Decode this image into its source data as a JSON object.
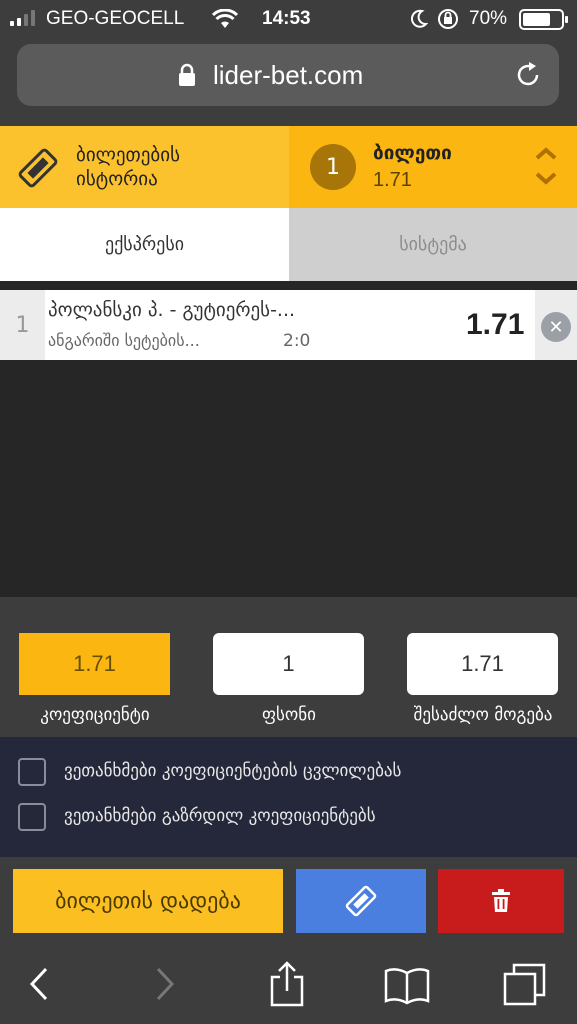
{
  "status_bar": {
    "carrier": "GEO-GEOCELL",
    "time": "14:53",
    "battery": "70%"
  },
  "browser": {
    "url": "lider-bet.com"
  },
  "header": {
    "history_label_line1": "ბილეთების",
    "history_label_line2": "ისტორია",
    "ticket_count": "1",
    "ticket_label": "ბილეთი",
    "ticket_odds": "1.71"
  },
  "tabs": [
    {
      "label": "ექსპრესი",
      "active": true
    },
    {
      "label": "სისტემა",
      "active": false
    }
  ],
  "bets": [
    {
      "index": "1",
      "title": "პოლანსკი პ. - გუტიერეს-...",
      "market": "ანგარიში სეტების...",
      "score": "2:0",
      "odds": "1.71"
    }
  ],
  "calculator": {
    "coefficient": {
      "value": "1.71",
      "caption": "კოეფიციენტი"
    },
    "stake": {
      "value": "1",
      "caption": "ფსონი"
    },
    "possible_win": {
      "value": "1.71",
      "caption": "შესაძლო მოგება"
    }
  },
  "agreements": [
    {
      "label": "ვეთანხმები კოეფიციენტების ცვლილებას",
      "checked": false
    },
    {
      "label": "ვეთანხმები გაზრდილ კოეფიციენტებს",
      "checked": false
    }
  ],
  "actions": {
    "place_bet_label": "ბილეთის დადება"
  },
  "colors": {
    "accent_yellow": "#fbb611",
    "delete_red": "#c81c1c",
    "ticket_blue": "#4a7fe0"
  }
}
